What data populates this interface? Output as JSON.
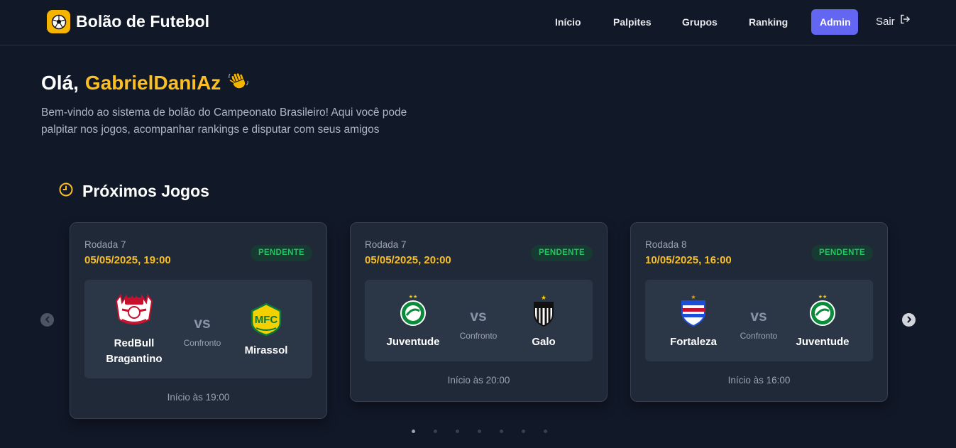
{
  "header": {
    "brand": "Bolão de Futebol",
    "nav": [
      {
        "label": "Início"
      },
      {
        "label": "Palpites"
      },
      {
        "label": "Grupos"
      },
      {
        "label": "Ranking"
      },
      {
        "label": "Admin"
      }
    ],
    "logout_label": "Sair"
  },
  "welcome": {
    "greeting": "Olá,",
    "username": "GabrielDaniAz",
    "emoji": "👋",
    "text": "Bem-vindo ao sistema de bolão do Campeonato Brasileiro! Aqui você pode palpitar nos jogos, acompanhar rankings e disputar com seus amigos"
  },
  "section": {
    "title": "Próximos Jogos",
    "icon": "clock-icon"
  },
  "games": [
    {
      "round": "Rodada 7",
      "datetime": "05/05/2025, 19:00",
      "status": "PENDENTE",
      "home": "RedBull Bragantino",
      "away": "Mirassol",
      "vs": "vs",
      "vs_label": "Confronto",
      "start": "Início às 19:00"
    },
    {
      "round": "Rodada 7",
      "datetime": "05/05/2025, 20:00",
      "status": "PENDENTE",
      "home": "Juventude",
      "away": "Galo",
      "vs": "vs",
      "vs_label": "Confronto",
      "start": "Início às 20:00"
    },
    {
      "round": "Rodada 8",
      "datetime": "10/05/2025, 16:00",
      "status": "PENDENTE",
      "home": "Fortaleza",
      "away": "Juventude",
      "vs": "vs",
      "vs_label": "Confronto",
      "start": "Início às 16:00"
    }
  ],
  "carousel": {
    "total_dots": 7,
    "active_dot": 0
  },
  "colors": {
    "background": "#111827",
    "accent": "#fbbf24",
    "admin_button": "#6366f1",
    "status_pending": "#22c55e",
    "card": "#1f2937"
  }
}
